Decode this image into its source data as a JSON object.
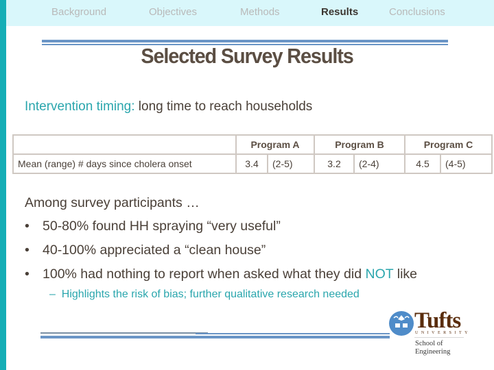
{
  "nav": {
    "items": [
      {
        "label": "Background",
        "active": false
      },
      {
        "label": "Objectives",
        "active": false
      },
      {
        "label": "Methods",
        "active": false
      },
      {
        "label": "Results",
        "active": true
      },
      {
        "label": "Conclusions",
        "active": false
      }
    ]
  },
  "slide": {
    "title": "Selected Survey Results",
    "subhead_accent": "Intervention timing:",
    "subhead_rest": " long time to reach households"
  },
  "table": {
    "headers": [
      "",
      "Program A",
      "Program B",
      "Program C"
    ],
    "rows": [
      {
        "label": "Mean (range) # days since cholera onset",
        "cells": [
          {
            "mean": "3.4",
            "range": "(2-5)"
          },
          {
            "mean": "3.2",
            "range": "(2-4)"
          },
          {
            "mean": "4.5",
            "range": "(4-5)"
          }
        ]
      }
    ]
  },
  "findings": {
    "intro": "Among survey participants …",
    "bullet_char": "•",
    "bullets": [
      {
        "text": "50-80% found HH spraying “very useful”"
      },
      {
        "text": "40-100% appreciated a “clean house”"
      },
      {
        "text_before": "100% had nothing to report when asked what they did ",
        "highlight": "NOT",
        "text_after": " like"
      }
    ],
    "sub_bullet": {
      "dash": "–",
      "text": "Highlights the risk of bias; further qualitative research needed"
    }
  },
  "logo": {
    "name": "Tufts",
    "university": "UNIVERSITY",
    "school_line1": "School of",
    "school_line2": "Engineering"
  },
  "colors": {
    "accent": "#2aa6ad",
    "left_bar": "#15aeb6",
    "nav_bg": "#d9f7fb",
    "rule": "#6a95c6",
    "tufts_brown": "#5a2d0c",
    "tufts_blue": "#4f8cc9"
  }
}
